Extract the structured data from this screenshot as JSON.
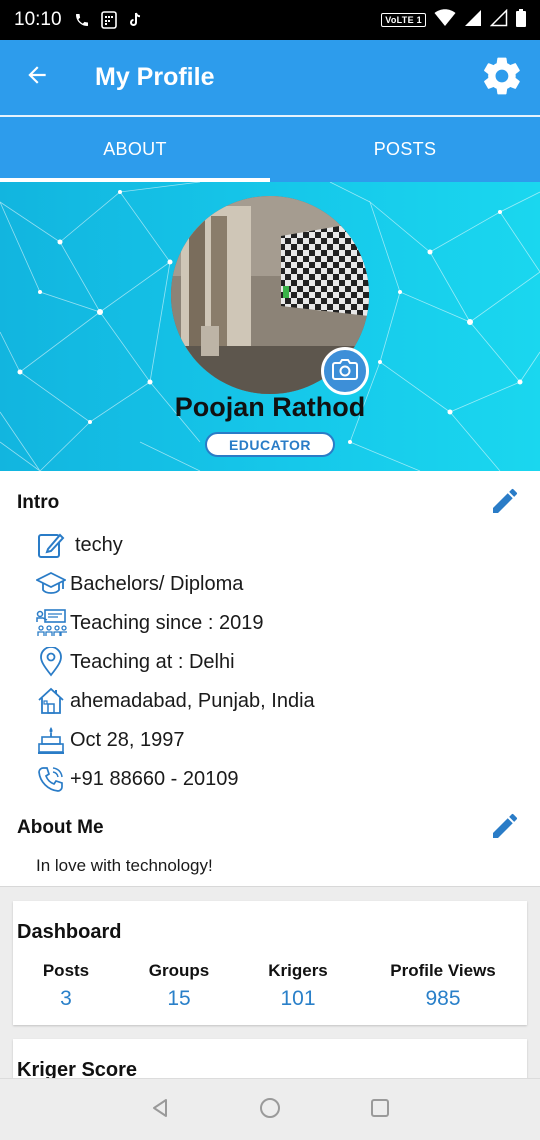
{
  "status_bar": {
    "time": "10:10",
    "network_label": "VoLTE 1",
    "icons": [
      "phone-icon",
      "sim-icon",
      "tiktok-icon",
      "wifi-icon",
      "signal-icon",
      "signal-empty-icon",
      "battery-icon"
    ]
  },
  "app_bar": {
    "title": "My Profile",
    "back_icon": "arrow-left-icon",
    "settings_icon": "gear-icon",
    "color": "#2d9cec"
  },
  "tabs": [
    {
      "label": "ABOUT",
      "active": true
    },
    {
      "label": "POSTS",
      "active": false
    }
  ],
  "profile": {
    "name": "Poojan Rathod",
    "role": "EDUCATOR",
    "camera_icon": "camera-icon"
  },
  "intro": {
    "title": "Intro",
    "items": [
      {
        "icon": "edit-note-icon",
        "text": "techy"
      },
      {
        "icon": "graduation-cap-icon",
        "text": "Bachelors/ Diploma"
      },
      {
        "icon": "classroom-icon",
        "text": "Teaching since : 2019"
      },
      {
        "icon": "location-pin-icon",
        "text": "Teaching at : Delhi"
      },
      {
        "icon": "home-icon",
        "text": "ahemadabad, Punjab, India"
      },
      {
        "icon": "cake-icon",
        "text": "Oct 28, 1997"
      },
      {
        "icon": "phone-ring-icon",
        "text": "+91 88660 - 20109"
      }
    ]
  },
  "about_me": {
    "title": "About Me",
    "text": "In love with technology!"
  },
  "dashboard": {
    "title": "Dashboard",
    "stats": [
      {
        "label": "Posts",
        "value": "3"
      },
      {
        "label": "Groups",
        "value": "15"
      },
      {
        "label": "Krigers",
        "value": "101"
      },
      {
        "label": "Profile Views",
        "value": "985"
      }
    ]
  },
  "kriger_score": {
    "title": "Kriger Score"
  },
  "nav_bar": {
    "icons": [
      "back-triangle-icon",
      "home-circle-icon",
      "recents-square-icon"
    ]
  },
  "colors": {
    "accent": "#2d9cec",
    "link_value": "#2a80c9",
    "banner": "#16c8ea"
  }
}
